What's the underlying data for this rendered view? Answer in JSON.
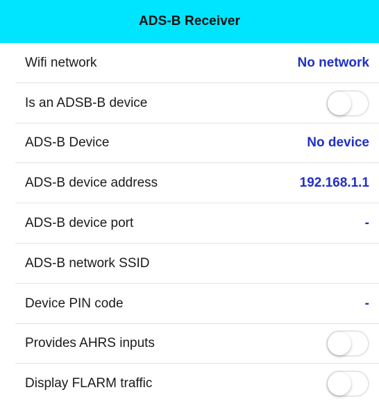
{
  "header": {
    "title": "ADS-B Receiver",
    "background_color": "#00e5ff"
  },
  "accent_color": "#1f2fc8",
  "rows": [
    {
      "label": "Wifi network",
      "value": "No network",
      "kind": "value"
    },
    {
      "label": "Is an ADSB-B device",
      "kind": "toggle",
      "on": false
    },
    {
      "label": "ADS-B Device",
      "value": "No device",
      "kind": "value"
    },
    {
      "label": "ADS-B device address",
      "value": "192.168.1.1",
      "kind": "value"
    },
    {
      "label": "ADS-B device port",
      "value": "-",
      "kind": "value"
    },
    {
      "label": "ADS-B network SSID",
      "value": "",
      "kind": "value"
    },
    {
      "label": "Device PIN code",
      "value": "-",
      "kind": "value"
    },
    {
      "label": "Provides AHRS inputs",
      "kind": "toggle",
      "on": false
    },
    {
      "label": "Display FLARM traffic",
      "kind": "toggle",
      "on": false
    }
  ]
}
